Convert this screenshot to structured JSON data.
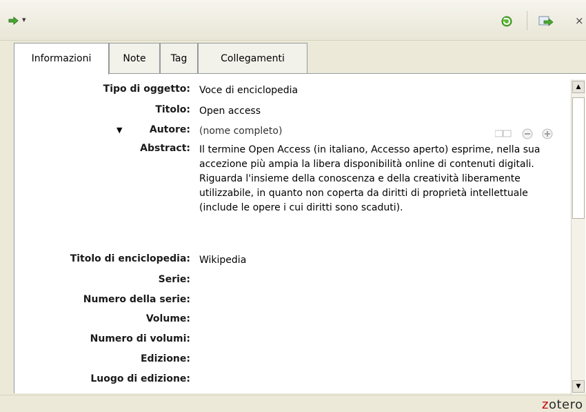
{
  "toolbar": {
    "nav_arrow_icon": "green-arrow-icon",
    "nav_dropdown": "▾",
    "sync_icon": "sync-icon",
    "locate_icon": "locate-icon",
    "close_label": "×"
  },
  "tabs": [
    {
      "label": "Informazioni",
      "active": true
    },
    {
      "label": "Note",
      "active": false
    },
    {
      "label": "Tag",
      "active": false
    },
    {
      "label": "Collegamenti",
      "active": false
    }
  ],
  "fields": [
    {
      "label": "Tipo di oggetto:",
      "value": "Voce di enciclopedia"
    },
    {
      "label": "Titolo:",
      "value": "Open access"
    },
    {
      "label": "Autore:",
      "value": "(nome completo)"
    },
    {
      "label": "Abstract:",
      "value": "Il termine Open Access (in italiano, Accesso aperto) esprime, nella sua accezione più ampia la libera disponibilità online di contenuti digitali. Riguarda l'insieme della conoscenza e della creatività liberamente utilizzabile, in quanto non coperta da diritti di proprietà intellettuale (include le opere i cui diritti sono scaduti)."
    },
    {
      "label": "Titolo di enciclopedia:",
      "value": "Wikipedia"
    },
    {
      "label": "Serie:",
      "value": ""
    },
    {
      "label": "Numero della serie:",
      "value": ""
    },
    {
      "label": "Volume:",
      "value": ""
    },
    {
      "label": "Numero di volumi:",
      "value": ""
    },
    {
      "label": "Edizione:",
      "value": ""
    },
    {
      "label": "Luogo di edizione:",
      "value": ""
    }
  ],
  "creator": {
    "toggle": "▼"
  },
  "brand": {
    "z": "z",
    "rest": "otero"
  },
  "colors": {
    "accent_green": "#3a9a2a",
    "brand_red": "#c80000"
  }
}
